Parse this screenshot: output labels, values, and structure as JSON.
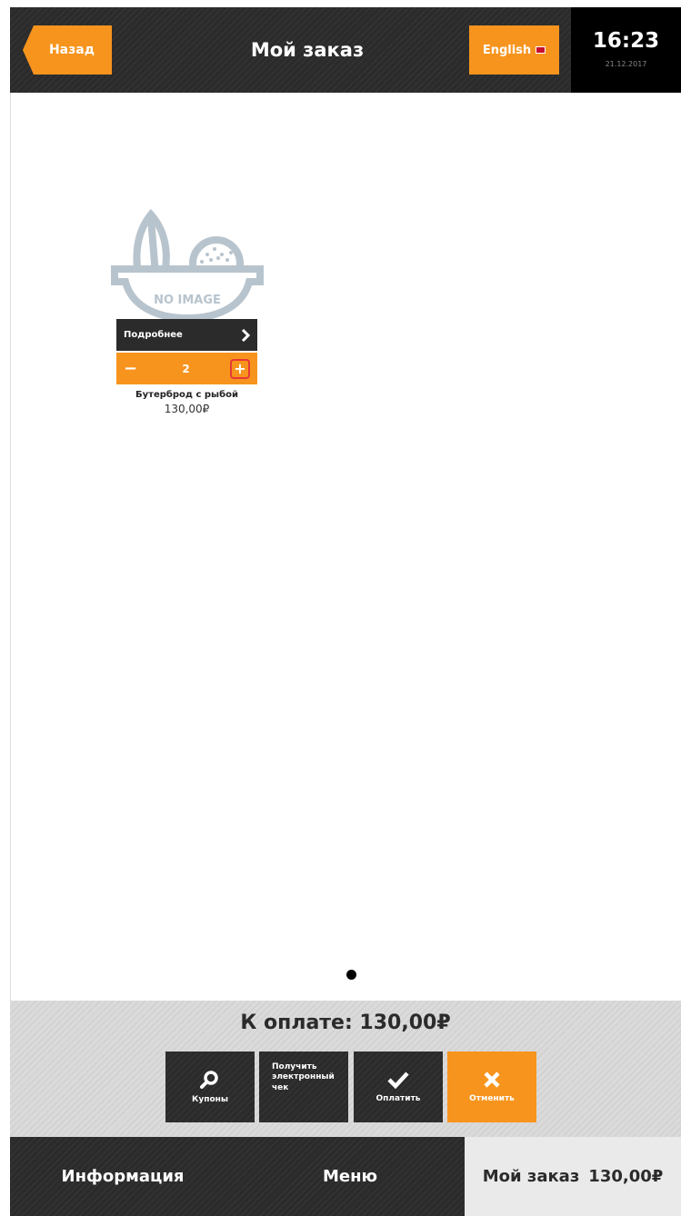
{
  "header": {
    "back_label": "Назад",
    "title": "Мой заказ",
    "language_label": "English",
    "time": "16:23",
    "date": "21.12.2017"
  },
  "product": {
    "image_text": "NO IMAGE",
    "details_label": "Подробнее",
    "quantity": "2",
    "minus": "−",
    "plus": "+",
    "name": "Бутерброд с рыбой",
    "price": "130,00₽"
  },
  "summary": {
    "total": "К оплате: 130,00₽"
  },
  "actions": {
    "coupons": "Купоны",
    "receipt": "Получить электронный чек",
    "pay": "Оплатить",
    "cancel": "Отменить"
  },
  "footer": {
    "info": "Информация",
    "menu": "Меню",
    "order_label": "Мой заказ",
    "order_total": "130,00₽"
  },
  "colors": {
    "accent": "#f7941d",
    "dark": "#2b2b2b",
    "clock_bg": "#000000",
    "highlight": "#e53935"
  }
}
